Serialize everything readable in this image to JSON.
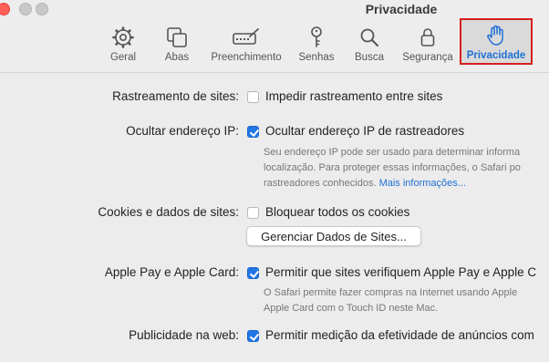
{
  "window": {
    "title": "Privacidade"
  },
  "toolbar": {
    "tabs": [
      {
        "label": "Geral",
        "icon": "gear-icon"
      },
      {
        "label": "Abas",
        "icon": "tabs-icon"
      },
      {
        "label": "Preenchimento",
        "icon": "autofill-icon"
      },
      {
        "label": "Senhas",
        "icon": "key-icon"
      },
      {
        "label": "Busca",
        "icon": "search-icon"
      },
      {
        "label": "Segurança",
        "icon": "lock-icon"
      },
      {
        "label": "Privacidade",
        "icon": "hand-icon",
        "selected": true
      }
    ],
    "accent_color": "#1f6fd6",
    "highlight_color": "#d71f1f"
  },
  "settings": {
    "tracking": {
      "label": "Rastreamento de sites:",
      "option": "Impedir rastreamento entre sites",
      "checked": false
    },
    "ip": {
      "label": "Ocultar endereço IP:",
      "option": "Ocultar endereço IP de rastreadores",
      "checked": true,
      "desc_line1": "Seu endereço IP pode ser usado para determinar informa",
      "desc_line2": "localização. Para proteger essas informações, o Safari po",
      "desc_line3": "rastreadores conhecidos.",
      "more_link": "Mais informações..."
    },
    "cookies": {
      "label": "Cookies e dados de sites:",
      "option": "Bloquear todos os cookies",
      "checked": false,
      "manage_button": "Gerenciar Dados de Sites..."
    },
    "applepay": {
      "label": "Apple Pay e Apple Card:",
      "option": "Permitir que sites verifiquem Apple Pay e Apple C",
      "checked": true,
      "desc_line1": "O Safari permite fazer compras na Internet usando Apple",
      "desc_line2": "Apple Card com o Touch ID neste Mac."
    },
    "ads": {
      "label": "Publicidade na web:",
      "option": "Permitir medição da efetividade de anúncios com",
      "checked": true
    }
  }
}
